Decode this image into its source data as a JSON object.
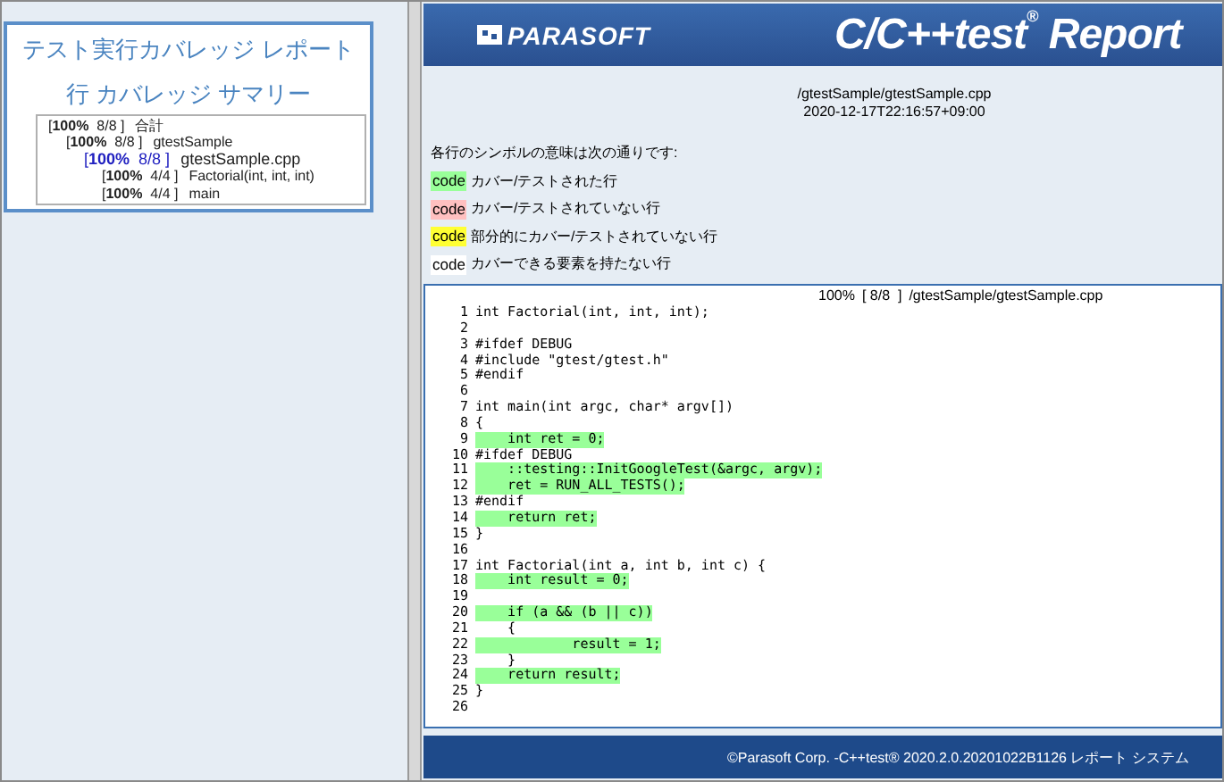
{
  "left_panel": {
    "title": "テスト実行カバレッジ レポート",
    "subtitle": "行 カバレッジ サマリー",
    "tree": [
      {
        "coverage": "[**100%**  8/8 ]",
        "name": "合計",
        "kind": "text",
        "children": [
          {
            "coverage": "[**100%**  8/8 ]",
            "name": "gtestSample",
            "kind": "text",
            "children": [
              {
                "coverage": "[**100%**  8/8 ]",
                "name": "gtestSample.cpp",
                "kind": "link",
                "children": [
                  {
                    "coverage": "[**100%**  4/4 ]",
                    "name": "Factorial(int, int, int)",
                    "kind": "text"
                  },
                  {
                    "coverage": "[**100%**  4/4 ]",
                    "name": "main",
                    "kind": "text"
                  }
                ]
              }
            ]
          }
        ]
      }
    ]
  },
  "header": {
    "logo": "PARASOFT",
    "title": "C/C++test$^{®}$ Report"
  },
  "file_info": {
    "path": "/gtestSample/gtestSample.cpp",
    "timestamp": "2020-12-17T22:16:57+09:00"
  },
  "legend": {
    "intro": "各行のシンボルの意味は次の通りです:",
    "items": [
      {
        "sample": "code",
        "label": "カバー/テストされた行",
        "color": "#99ff99"
      },
      {
        "sample": "code",
        "label": "カバー/テストされていない行",
        "color": "#ffc0c0"
      },
      {
        "sample": "code",
        "label": "部分的にカバー/テストされていない行",
        "color": "#ffff33"
      },
      {
        "sample": "code",
        "label": "カバーできる要素を持たない行",
        "color": "#ffffff"
      }
    ]
  },
  "code_view": {
    "percent": "100%",
    "count": "[ 8/8  ]",
    "path": "/gtestSample/gtestSample.cpp",
    "lines": [
      {
        "number": "1",
        "text": "int Factorial(int, int, int);",
        "covered": false
      },
      {
        "number": "2",
        "covered": false
      },
      {
        "number": "3",
        "text": "#ifdef DEBUG",
        "covered": false
      },
      {
        "number": "4",
        "text": "#include \"gtest/gtest.h\"",
        "covered": false
      },
      {
        "number": "5",
        "text": "#endif",
        "covered": false
      },
      {
        "number": "6",
        "covered": false
      },
      {
        "number": "7",
        "text": "int main(int argc, char* argv[])",
        "covered": false
      },
      {
        "number": "8",
        "text": "{",
        "covered": false
      },
      {
        "number": "9",
        "text": "    int ret = 0;",
        "covered": true
      },
      {
        "number": "10",
        "text": "#ifdef DEBUG",
        "covered": false
      },
      {
        "number": "11",
        "text": "    ::testing::InitGoogleTest(&argc, argv);",
        "covered": true
      },
      {
        "number": "12",
        "text": "    ret = RUN_ALL_TESTS();",
        "covered": true
      },
      {
        "number": "13",
        "text": "#endif",
        "covered": false
      },
      {
        "number": "14",
        "text": "    return ret;",
        "covered": true
      },
      {
        "number": "15",
        "text": "}",
        "covered": false
      },
      {
        "number": "16",
        "covered": false
      },
      {
        "number": "17",
        "text": "int Factorial(int a, int b, int c) {",
        "covered": false
      },
      {
        "number": "18",
        "text": "    int result = 0;",
        "covered": true
      },
      {
        "number": "19",
        "covered": false
      },
      {
        "number": "20",
        "text": "    if (a && (b || c))",
        "covered": true
      },
      {
        "number": "21",
        "text": "    {",
        "covered": false
      },
      {
        "number": "22",
        "text": "            result = 1;",
        "covered": true
      },
      {
        "number": "23",
        "text": "    }",
        "covered": false
      },
      {
        "number": "24",
        "text": "    return result;",
        "covered": true
      },
      {
        "number": "25",
        "text": "}",
        "covered": false
      },
      {
        "number": "26",
        "covered": false
      }
    ]
  },
  "footer": {
    "text": "©Parasoft Corp. -C++test® 2020.2.0.20201022B1126 レポート システム"
  }
}
